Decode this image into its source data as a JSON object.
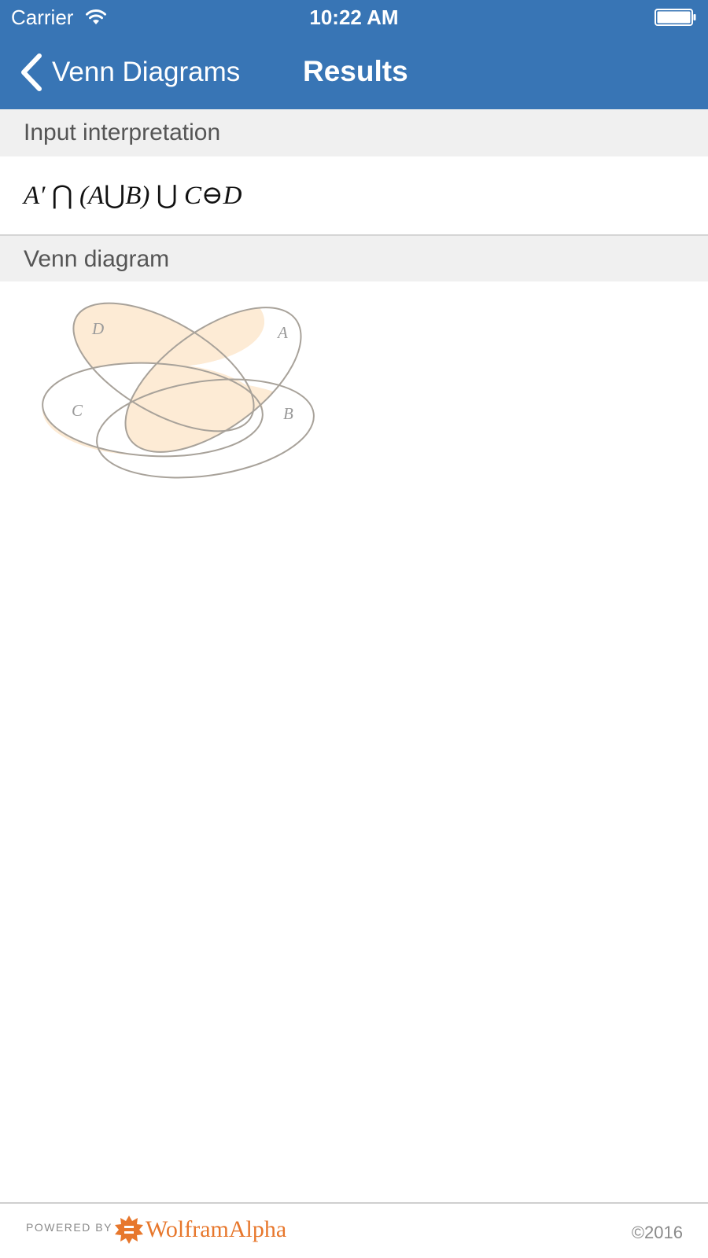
{
  "status_bar": {
    "carrier": "Carrier",
    "time": "10:22 AM",
    "wifi_icon": "wifi-icon",
    "battery_icon": "battery-full-icon"
  },
  "nav": {
    "back_label": "Venn Diagrams",
    "back_icon": "chevron-left-icon",
    "title": "Results",
    "bar_color": "#3875b5"
  },
  "pods": [
    {
      "title": "Input interpretation",
      "formula": {
        "parts": [
          "A′",
          "⋂",
          "(A",
          "⋃",
          "B)",
          "⋃",
          "C",
          "⊖",
          "D"
        ]
      }
    },
    {
      "title": "Venn diagram",
      "diagram": {
        "sets": [
          "A",
          "B",
          "C",
          "D"
        ],
        "shaded_color": "#fdebd5",
        "outline_color": "#a8a29a"
      }
    }
  ],
  "footer": {
    "powered_by": "POWERED BY",
    "brand": "WolframAlpha",
    "brand_icon": "wolfram-sun-icon",
    "brand_color": "#e7772c",
    "copyright": "©2016"
  }
}
